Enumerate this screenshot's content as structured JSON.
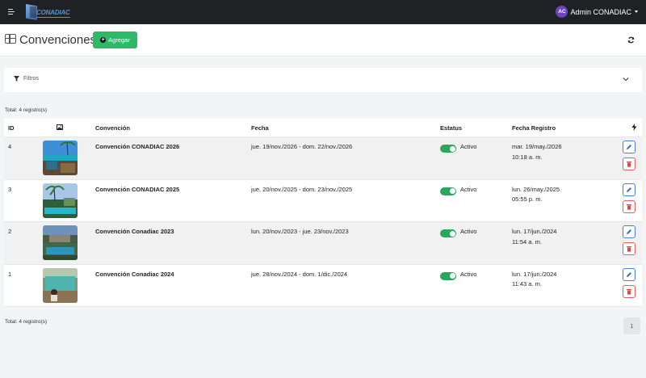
{
  "navbar": {
    "logo_text": "CONADIAC",
    "user": {
      "initials": "AC",
      "name": "Admin CONADIAC"
    }
  },
  "header": {
    "title": "Convenciones",
    "add_label": "Agregar"
  },
  "filters": {
    "label": "Filtros"
  },
  "total": {
    "label": "Total:",
    "count_text": "4 registro(s)"
  },
  "table": {
    "columns": {
      "id": "ID",
      "convention": "Convención",
      "date": "Fecha",
      "status": "Estatus",
      "registered": "Fecha Registro"
    },
    "rows": [
      {
        "id": "4",
        "name": "Convención CONADIAC 2026",
        "date": "jue. 19/nov./2026 - dom. 22/nov./2026",
        "status": "Activo",
        "reg_date": "mar. 19/may./2026",
        "reg_time": "10:18 a. m."
      },
      {
        "id": "3",
        "name": "Convención CONADIAC 2025",
        "date": "jue. 20/nov./2025 - dom. 23/nov./2025",
        "status": "Activo",
        "reg_date": "lun. 26/may./2025",
        "reg_time": "05:55 p. m."
      },
      {
        "id": "2",
        "name": "Convención Conadiac 2023",
        "date": "lun. 20/nov./2023 - jue. 23/nov./2023",
        "status": "Activo",
        "reg_date": "lun. 17/jun./2024",
        "reg_time": "11:54 a. m."
      },
      {
        "id": "1",
        "name": "Convención Conadiac 2024",
        "date": "jue. 28/nov./2024 - dom. 1/dic./2024",
        "status": "Activo",
        "reg_date": "lun. 17/jun./2024",
        "reg_time": "11:43 a. m."
      }
    ]
  },
  "pagination": {
    "current_page": "1"
  },
  "colors": {
    "accent_green": "#2db968",
    "toggle_on": "#2aa75a",
    "edit": "#4a7fd8",
    "delete": "#e35d5d",
    "navbar": "#1f2124",
    "avatar": "#6f42c1"
  }
}
